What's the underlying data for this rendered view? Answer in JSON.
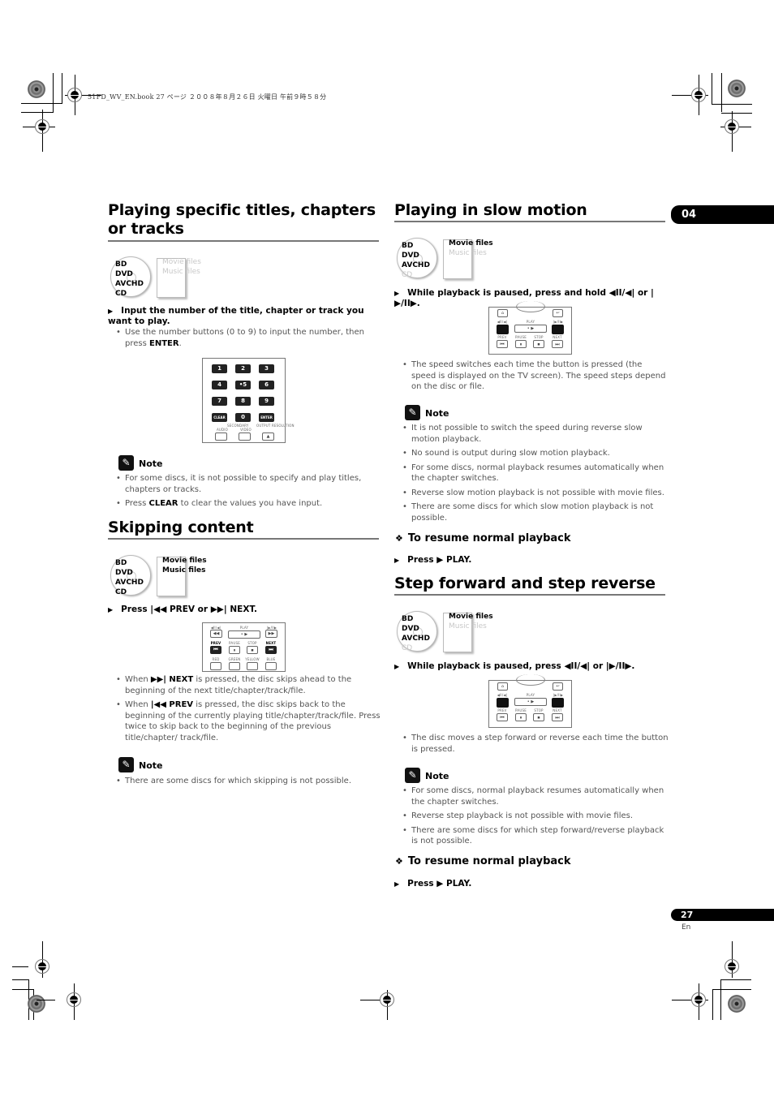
{
  "print_header": "51FD_WV_EN.book  27 ページ  ２００８年８月２６日  火曜日  午前９時５８分",
  "chapter_tab": "04",
  "page": {
    "number": "27",
    "lang": "En"
  },
  "icons": {
    "note": "pencil-note-icon",
    "step_arrow": "▶",
    "diamond": "❖"
  },
  "sections": {
    "specific": {
      "title": "Playing specific titles, chapters or tracks",
      "media": {
        "discs": [
          {
            "label": "BD",
            "active": true
          },
          {
            "label": "DVD",
            "active": true
          },
          {
            "label": "AVCHD",
            "active": true
          },
          {
            "label": "CD",
            "active": true
          }
        ],
        "files": [
          {
            "label": "Movie files",
            "active": false
          },
          {
            "label": "Music files",
            "active": false
          }
        ]
      },
      "step": "Input the number of the title, chapter or track you want to play.",
      "bullets": [
        {
          "pre": "Use the number buttons (0 to 9) to input the number, then press ",
          "bold": "ENTER",
          "post": "."
        }
      ],
      "remote": {
        "keys": [
          "1",
          "2",
          "3",
          "4",
          "•5",
          "6",
          "7",
          "8",
          "9",
          "CLEAR",
          "0",
          "ENTER"
        ],
        "bottom_labels": [
          "AUDIO",
          "VIDEO",
          "OUTPUT RESOLUTION"
        ],
        "group_label": "SECONDARY",
        "arrow": "▲"
      },
      "note_label": "Note",
      "notes": [
        {
          "pre": "For some discs, it is not possible to specify and play titles, chapters or tracks.",
          "bold": "",
          "post": ""
        },
        {
          "pre": "Press ",
          "bold": "CLEAR",
          "post": " to clear the values you have input."
        }
      ]
    },
    "skipping": {
      "title": "Skipping content",
      "media": {
        "discs": [
          {
            "label": "BD",
            "active": true
          },
          {
            "label": "DVD",
            "active": true
          },
          {
            "label": "AVCHD",
            "active": true
          },
          {
            "label": "CD",
            "active": true
          }
        ],
        "files": [
          {
            "label": "Movie files",
            "active": true
          },
          {
            "label": "Music files",
            "active": true
          }
        ]
      },
      "step": "Press |◀◀ PREV or ▶▶| NEXT.",
      "remote": {
        "top_labels": [
          "◀II/◀|",
          "PLAY",
          "|▶/II▶"
        ],
        "play_glyph": "• ▶",
        "mid_labels": [
          "PREV",
          "PAUSE",
          "STOP",
          "NEXT"
        ],
        "color_labels": [
          "RED",
          "GREEN",
          "YELLOW",
          "BLUE"
        ]
      },
      "bullets": [
        {
          "pre": "When ",
          "bold": "▶▶| NEXT",
          "post": " is pressed, the disc skips ahead to the beginning of the next title/chapter/track/file."
        },
        {
          "pre": "When ",
          "bold": "|◀◀ PREV",
          "post": " is pressed, the disc skips back to the beginning of the currently playing title/chapter/track/file. Press twice to skip back to the beginning of the previous title/chapter/ track/file."
        }
      ],
      "note_label": "Note",
      "notes": [
        {
          "pre": "There are some discs for which skipping is not possible.",
          "bold": "",
          "post": ""
        }
      ]
    },
    "slow": {
      "title": "Playing in slow motion",
      "media": {
        "discs": [
          {
            "label": "BD",
            "active": true
          },
          {
            "label": "DVD",
            "active": true
          },
          {
            "label": "AVCHD",
            "active": true
          },
          {
            "label": "CD",
            "active": false
          }
        ],
        "files": [
          {
            "label": "Movie files",
            "active": true
          },
          {
            "label": "Music files",
            "active": false
          }
        ]
      },
      "step": "While playback is paused, press and hold ◀II/◀| or |▶/II▶.",
      "remote": {
        "top_labels": [
          "◀II/◀|",
          "PLAY",
          "|▶/II▶"
        ],
        "play_glyph": "• ▶",
        "mid_labels": [
          "PREV",
          "PAUSE",
          "STOP",
          "NEXT"
        ]
      },
      "bullets": [
        {
          "pre": "The speed switches each time the button is pressed (the speed is displayed on the TV screen). The speed steps depend on the disc or file.",
          "bold": "",
          "post": ""
        }
      ],
      "note_label": "Note",
      "notes": [
        {
          "pre": "It is not possible to switch the speed during reverse slow motion playback.",
          "bold": "",
          "post": ""
        },
        {
          "pre": "No sound is output during slow motion playback.",
          "bold": "",
          "post": ""
        },
        {
          "pre": "For some discs, normal playback resumes automatically when the chapter switches.",
          "bold": "",
          "post": ""
        },
        {
          "pre": "Reverse slow motion playback is not possible with movie files.",
          "bold": "",
          "post": ""
        },
        {
          "pre": "There are some discs for which slow motion playback is not possible.",
          "bold": "",
          "post": ""
        }
      ],
      "resume_title": "To resume normal playback",
      "resume_step": "Press ▶ PLAY."
    },
    "step": {
      "title": "Step forward and step reverse",
      "media": {
        "discs": [
          {
            "label": "BD",
            "active": true
          },
          {
            "label": "DVD",
            "active": true
          },
          {
            "label": "AVCHD",
            "active": true
          },
          {
            "label": "CD",
            "active": false
          }
        ],
        "files": [
          {
            "label": "Movie files",
            "active": true
          },
          {
            "label": "Music files",
            "active": false
          }
        ]
      },
      "step": "While playback is paused, press ◀II/◀| or |▶/II▶.",
      "remote": {
        "top_labels": [
          "◀II/◀|",
          "PLAY",
          "|▶/II▶"
        ],
        "play_glyph": "• ▶",
        "mid_labels": [
          "PREV",
          "PAUSE",
          "STOP",
          "NEXT"
        ]
      },
      "bullets": [
        {
          "pre": "The disc moves a step forward or reverse each time the button is pressed.",
          "bold": "",
          "post": ""
        }
      ],
      "note_label": "Note",
      "notes": [
        {
          "pre": "For some discs, normal playback resumes automatically when the chapter switches.",
          "bold": "",
          "post": ""
        },
        {
          "pre": "Reverse step playback is not possible with movie files.",
          "bold": "",
          "post": ""
        },
        {
          "pre": "There are some discs for which step forward/reverse playback is not possible.",
          "bold": "",
          "post": ""
        }
      ],
      "resume_title": "To resume normal playback",
      "resume_step": "Press ▶ PLAY."
    }
  }
}
